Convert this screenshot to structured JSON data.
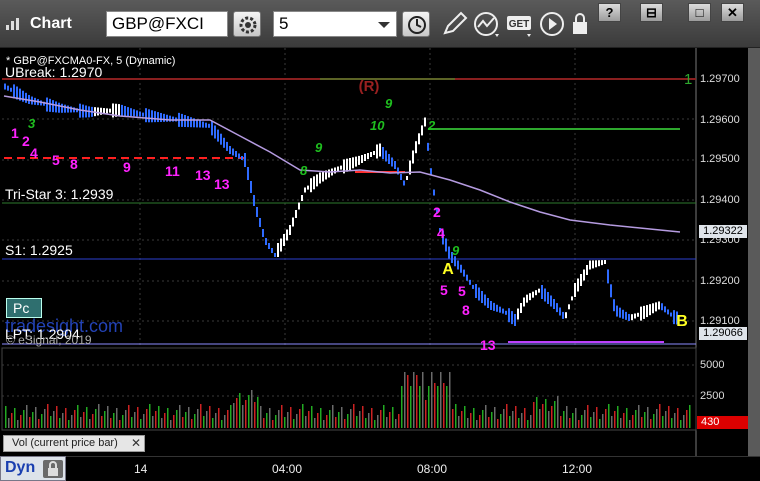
{
  "window": {
    "title": "Chart",
    "controls": [
      "?",
      "⊟",
      "□",
      "✕"
    ]
  },
  "toolbar": {
    "symbol_value": "GBP@FXCI",
    "interval_value": "5",
    "icons": [
      "gear-icon",
      "clock-icon",
      "pencil-icon",
      "trend-icon",
      "get-icon",
      "play-icon",
      "lock-icon"
    ],
    "get_label": "GET"
  },
  "chart": {
    "symbol_line": "* GBP@FXCMA0-FX, 5 (Dynamic)",
    "ubreak": "UBreak: 1.2970",
    "tristar": "Tri-Star 3: 1.2939",
    "s1": "S1: 1.2925",
    "lpt": "LPT: 1.2904",
    "copyright": "© eSignal, 2019",
    "watermark": "tradesight.com",
    "pc_badge": "Pc",
    "marker_r": "(R)",
    "marker_a": "A",
    "marker_b": "B",
    "marker_1": "1",
    "price_axis": [
      "1.29700",
      "1.29600",
      "1.29500",
      "1.29400",
      "1.29300",
      "1.29200",
      "1.29100"
    ],
    "price_highlight_ma": "1.29322",
    "price_highlight_last": "1.29066",
    "count_labels": [
      "1",
      "2",
      "3",
      "4",
      "5",
      "8",
      "9",
      "10",
      "11",
      "12",
      "13"
    ],
    "colors": {
      "up_candle": "#ffffff",
      "down_candle": "#2f6bff",
      "ma_line": "#b59be0",
      "ubreak_line": "#8a1f1f",
      "tristar_line": "#2e7a2e",
      "s1_line": "#2b3fd0",
      "lpt_line": "#8c8cff",
      "count_magenta": "#ff22ff",
      "count_green": "#1fbf1f"
    }
  },
  "volume": {
    "axis": [
      "5000",
      "2500"
    ],
    "current_value": "430",
    "tab_label": "Vol (current price bar)",
    "tab_close": "✕"
  },
  "time_axis": {
    "dyn_label": "Dyn",
    "labels": [
      "14",
      "04:00",
      "08:00",
      "12:00"
    ]
  }
}
